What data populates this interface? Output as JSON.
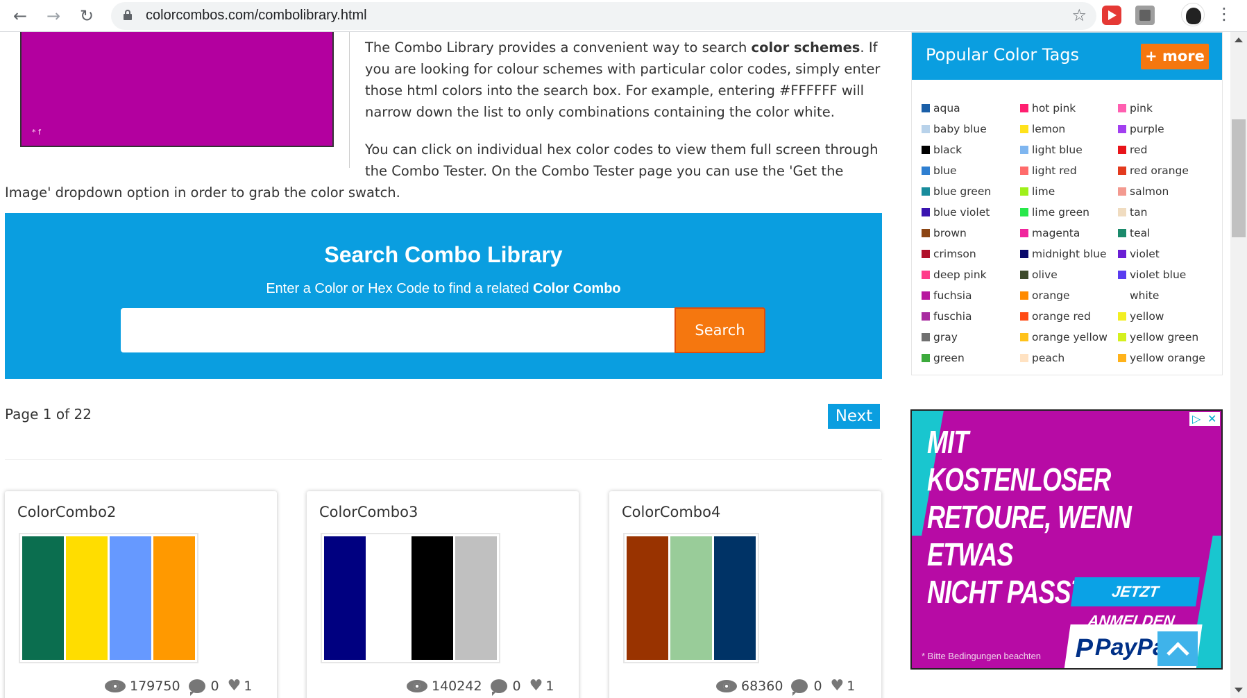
{
  "browser": {
    "url": "colorcombos.com/combolibrary.html"
  },
  "intro": {
    "para1_a": "The Combo Library provides a convenient way to search ",
    "para1_b": "color schemes",
    "para1_c": ". If you are looking for colour schemes with particular color codes, simply enter those html colors into the search box. For example, entering #FFFFFF will narrow down the list to only combinations containing the color white.",
    "para2_a": "You can click on individual hex color codes to view them full screen through the Combo Tester. On the Combo Tester page you can use the 'Get the",
    "para2_b": "Image' dropdown option in order to grab the color swatch.",
    "hero_caption": "* f"
  },
  "search": {
    "title": "Search Combo Library",
    "subtitle_a": "Enter a Color or Hex Code to find a related ",
    "subtitle_b": "Color Combo",
    "input_value": "",
    "button_label": "Search"
  },
  "pagination": {
    "page_text": "Page 1 of 22",
    "next_label": "Next"
  },
  "combos": [
    {
      "title": "ColorCombo2",
      "colors": [
        "#0b6e4f",
        "#ffdd00",
        "#6699ff",
        "#ff9900"
      ],
      "views": "179750",
      "comments": "0",
      "likes": "1"
    },
    {
      "title": "ColorCombo3",
      "colors": [
        "#000080",
        "#ffffff",
        "#000000",
        "#c0c0c0"
      ],
      "views": "140242",
      "comments": "0",
      "likes": "1"
    },
    {
      "title": "ColorCombo4",
      "colors": [
        "#993300",
        "#99cc99",
        "#003366"
      ],
      "views": "68360",
      "comments": "0",
      "likes": "1"
    }
  ],
  "tags": {
    "title": "Popular Color Tags",
    "more_label": "more",
    "columns": [
      [
        {
          "label": "aqua",
          "color": "#1a5fa8"
        },
        {
          "label": "baby blue",
          "color": "#b8d2ea"
        },
        {
          "label": "black",
          "color": "#000000"
        },
        {
          "label": "blue",
          "color": "#2f7fd1"
        },
        {
          "label": "blue green",
          "color": "#188c9c"
        },
        {
          "label": "blue violet",
          "color": "#3a14b0"
        },
        {
          "label": "brown",
          "color": "#8b4513"
        },
        {
          "label": "crimson",
          "color": "#b0102a"
        },
        {
          "label": "deep pink",
          "color": "#ff3c8a"
        },
        {
          "label": "fuchsia",
          "color": "#b7169e"
        },
        {
          "label": "fuschia",
          "color": "#a82ba0"
        },
        {
          "label": "gray",
          "color": "#707070"
        },
        {
          "label": "green",
          "color": "#3caa3c"
        }
      ],
      [
        {
          "label": "hot pink",
          "color": "#ff1f70"
        },
        {
          "label": "lemon",
          "color": "#ffe21c"
        },
        {
          "label": "light blue",
          "color": "#7fb6f0"
        },
        {
          "label": "light red",
          "color": "#ff6b6b"
        },
        {
          "label": "lime",
          "color": "#9ef01a"
        },
        {
          "label": "lime green",
          "color": "#27e84a"
        },
        {
          "label": "magenta",
          "color": "#f0259c"
        },
        {
          "label": "midnight blue",
          "color": "#0a0a6b"
        },
        {
          "label": "olive",
          "color": "#3d4a2a"
        },
        {
          "label": "orange",
          "color": "#ff8a00"
        },
        {
          "label": "orange red",
          "color": "#ff4a14"
        },
        {
          "label": "orange yellow",
          "color": "#ffc21a"
        },
        {
          "label": "peach",
          "color": "#ffe2c2"
        }
      ],
      [
        {
          "label": "pink",
          "color": "#ff5fb0"
        },
        {
          "label": "purple",
          "color": "#a23ff0"
        },
        {
          "label": "red",
          "color": "#e8141a"
        },
        {
          "label": "red orange",
          "color": "#e33a1e"
        },
        {
          "label": "salmon",
          "color": "#f39a90"
        },
        {
          "label": "tan",
          "color": "#f0dcc0"
        },
        {
          "label": "teal",
          "color": "#1b8a6b"
        },
        {
          "label": "violet",
          "color": "#6a1fd4"
        },
        {
          "label": "violet blue",
          "color": "#5a3cf0"
        },
        {
          "label": "white",
          "color": "#ffffff"
        },
        {
          "label": "yellow",
          "color": "#f2ef22"
        },
        {
          "label": "yellow green",
          "color": "#d4f01e"
        },
        {
          "label": "yellow orange",
          "color": "#ffb21a"
        }
      ]
    ]
  },
  "ad": {
    "headline_1": "MIT KOSTENLOSER",
    "headline_2": "RETOURE, WENN ETWAS",
    "headline_3": "NICHT PASST*",
    "cta": "JETZT ANMELDEN",
    "brand": "PayPal",
    "note": "* Bitte Bedingungen beachten"
  }
}
